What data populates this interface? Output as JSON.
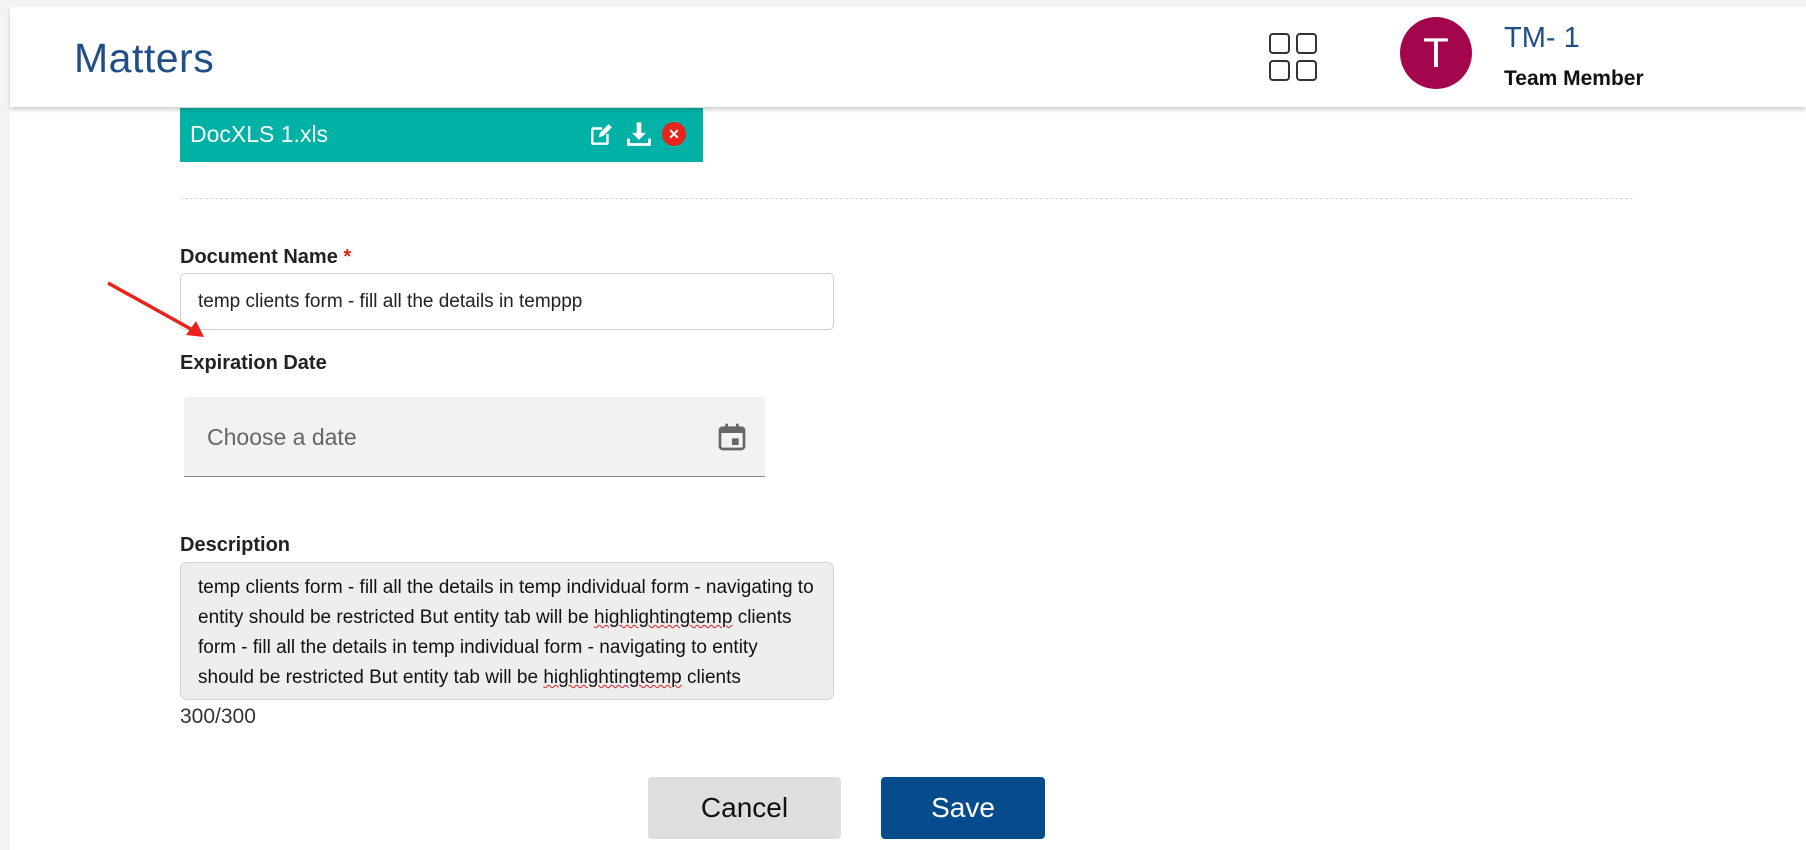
{
  "header": {
    "app_title": "Matters",
    "apps_icon": "grid-icon",
    "user": {
      "avatar_letter": "T",
      "avatar_color": "#a4064e",
      "name": "TM- 1",
      "role": "Team Member"
    }
  },
  "file": {
    "name": "DocXLS 1.xls",
    "bar_color": "#00b1a6",
    "icons": [
      "edit-icon",
      "download-icon",
      "remove-icon"
    ]
  },
  "form": {
    "document_name": {
      "label": "Document Name",
      "required_marker": "*",
      "value": "temp clients form - fill all the details in temppp"
    },
    "expiration_date": {
      "label": "Expiration Date",
      "placeholder": "Choose a date",
      "icon": "calendar-icon"
    },
    "description": {
      "label": "Description",
      "segments": [
        "temp clients form - fill all the details in temp individual form - navigating to entity should be restricted But entity tab will be ",
        "highlightingtemp",
        " clients form - fill all the details in temp individual form - navigating to entity should be restricted But entity tab will be ",
        "highlightingtemp",
        " clients"
      ],
      "counter": "300/300"
    }
  },
  "actions": {
    "cancel_label": "Cancel",
    "save_label": "Save",
    "save_color": "#064c8d"
  }
}
